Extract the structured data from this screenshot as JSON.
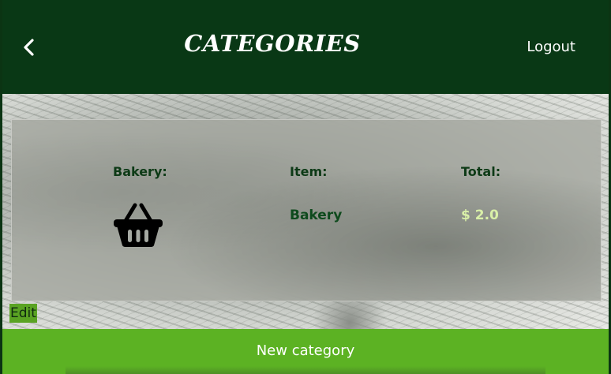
{
  "header": {
    "title": "CATEGORIES",
    "logout_label": "Logout",
    "back_icon": "chevron-left-icon"
  },
  "card": {
    "category_label": "Bakery:",
    "item_label": "Item:",
    "total_label": "Total:",
    "item_value": "Bakery",
    "total_value": "$ 2.0",
    "icon": "basket-icon"
  },
  "actions": {
    "edit_label": "Edit",
    "new_category_label": "New category"
  },
  "colors": {
    "header_bg": "#093815",
    "accent_green": "#5cb223",
    "dark_green_text": "#0d3a16",
    "total_text": "#d9f0a8"
  }
}
